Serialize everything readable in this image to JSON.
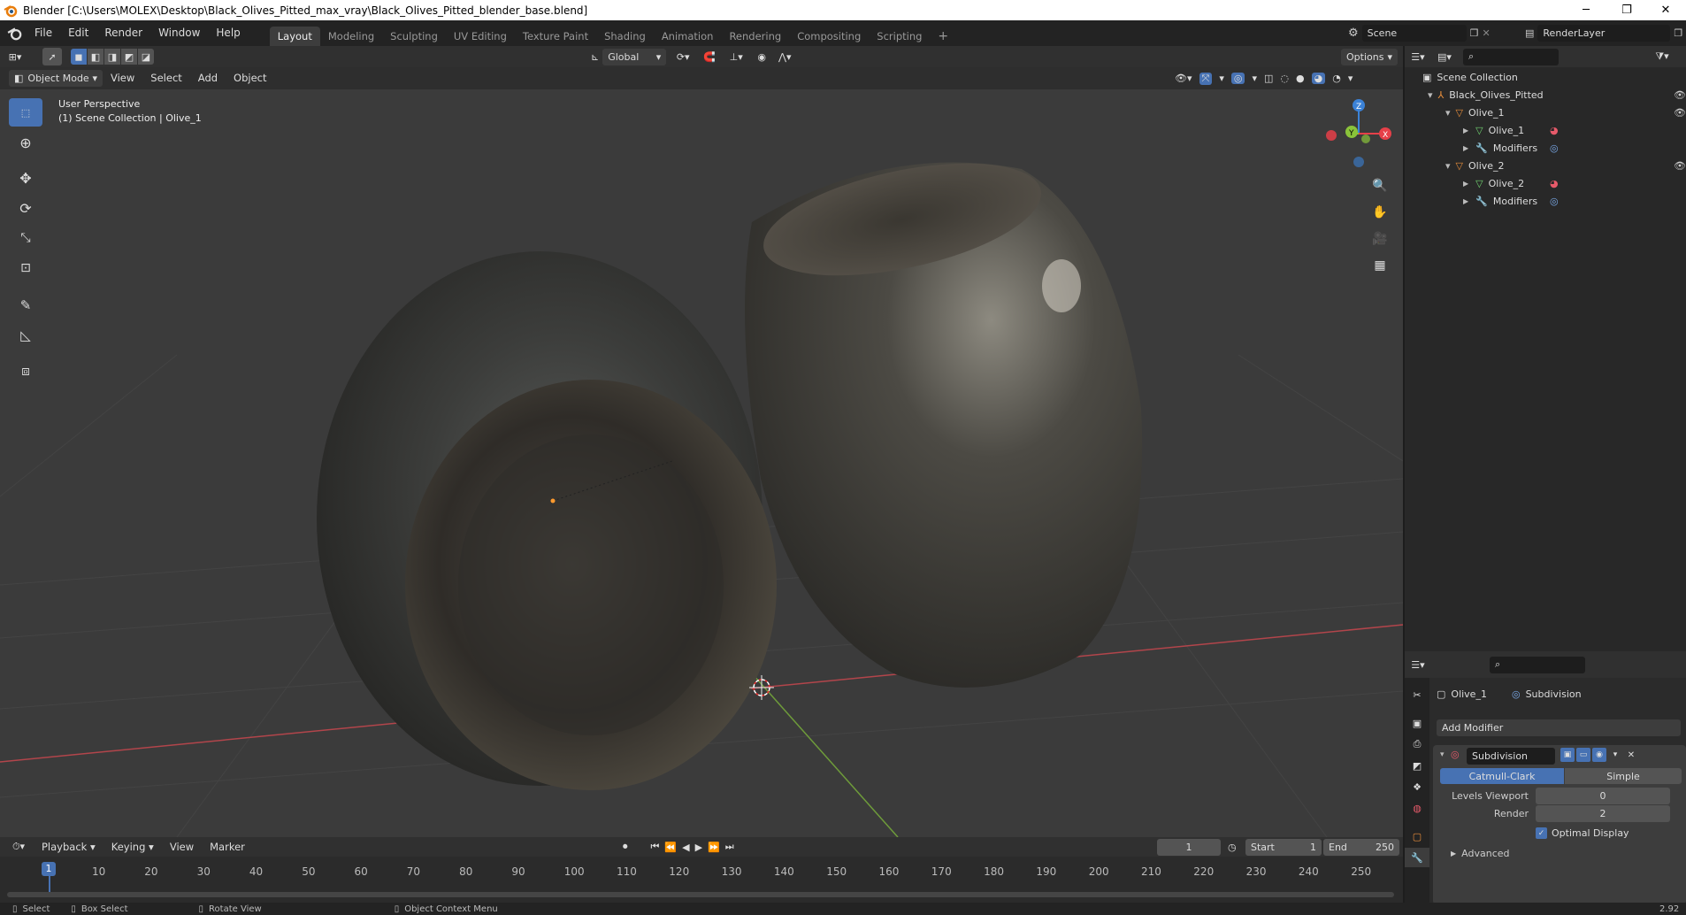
{
  "window": {
    "title": "Blender [C:\\Users\\MOLEX\\Desktop\\Black_Olives_Pitted_max_vray\\Black_Olives_Pitted_blender_base.blend]",
    "controls": [
      "─",
      "❐",
      "✕"
    ]
  },
  "menu": [
    "File",
    "Edit",
    "Render",
    "Window",
    "Help"
  ],
  "workspaces": [
    {
      "label": "Layout",
      "active": true
    },
    {
      "label": "Modeling"
    },
    {
      "label": "Sculpting"
    },
    {
      "label": "UV Editing"
    },
    {
      "label": "Texture Paint"
    },
    {
      "label": "Shading"
    },
    {
      "label": "Animation"
    },
    {
      "label": "Rendering"
    },
    {
      "label": "Compositing"
    },
    {
      "label": "Scripting"
    }
  ],
  "add_workspace": "+",
  "scene": {
    "name": "Scene",
    "render_layer": "RenderLayer"
  },
  "viewport_header": {
    "transform_orientation": "Global",
    "options": "Options",
    "mode": "Object Mode",
    "menus": [
      "View",
      "Select",
      "Add",
      "Object"
    ]
  },
  "viewport": {
    "perspective": "User Perspective",
    "collection_info": "(1) Scene Collection | Olive_1",
    "gizmo": {
      "z": "Z",
      "y": "Y",
      "x": "X"
    }
  },
  "outliner": {
    "root": "Scene Collection",
    "items": [
      {
        "label": "Black_Olives_Pitted",
        "depth": 1
      },
      {
        "label": "Olive_1",
        "depth": 2
      },
      {
        "label": "Olive_1",
        "depth": 3
      },
      {
        "label": "Modifiers",
        "depth": 3
      },
      {
        "label": "Olive_2",
        "depth": 2
      },
      {
        "label": "Olive_2",
        "depth": 3
      },
      {
        "label": "Modifiers",
        "depth": 3
      }
    ]
  },
  "properties": {
    "object": "Olive_1",
    "modifier_context": "Subdivision",
    "add_modifier": "Add Modifier",
    "modifier": {
      "name": "Subdivision",
      "types": [
        "Catmull-Clark",
        "Simple"
      ],
      "active_type": "Catmull-Clark",
      "levels_viewport_label": "Levels Viewport",
      "levels_viewport": "0",
      "render_label": "Render",
      "render": "2",
      "optimal_display_label": "Optimal Display",
      "optimal_display": true,
      "advanced_label": "Advanced"
    }
  },
  "timeline": {
    "menus": [
      "Playback",
      "Keying",
      "View",
      "Marker"
    ],
    "current_frame": "1",
    "start_label": "Start",
    "start": "1",
    "end_label": "End",
    "end": "250",
    "ticks": [
      "10",
      "20",
      "30",
      "40",
      "50",
      "60",
      "70",
      "80",
      "90",
      "100",
      "110",
      "120",
      "130",
      "140",
      "150",
      "160",
      "170",
      "180",
      "190",
      "200",
      "210",
      "220",
      "230",
      "240",
      "250"
    ],
    "playhead": "1"
  },
  "statusbar": {
    "select": "Select",
    "box_select": "Box Select",
    "rotate": "Rotate View",
    "context_menu": "Object Context Menu",
    "version": "2.92"
  },
  "colors": {
    "accent": "#4772b3",
    "x_axis": "#e64049",
    "y_axis": "#8ac33a",
    "z_axis": "#3b82d7"
  }
}
